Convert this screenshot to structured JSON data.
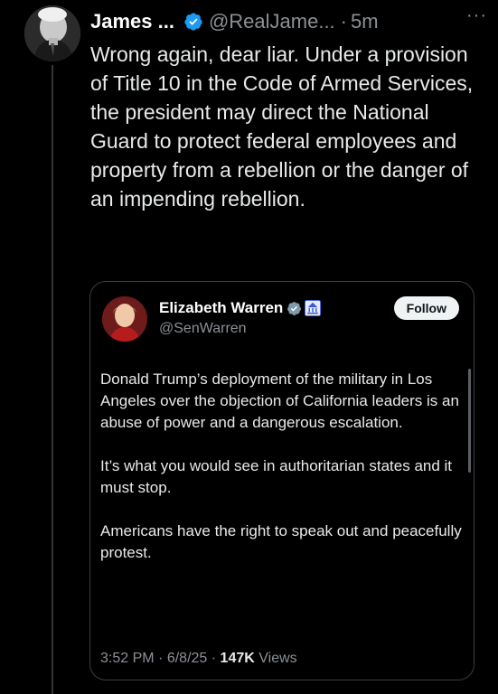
{
  "tweet": {
    "author_name": "James ...",
    "author_handle": "@RealJame...",
    "separator": "·",
    "time": "5m",
    "more_icon": "···",
    "text": "Wrong again, dear liar. Under a provision of Title 10 in the Code of Armed Services, the president may direct the National Guard to protect federal employees and property from a rebellion or the danger of an impending rebellion."
  },
  "quote": {
    "author_name": "Elizabeth Warren",
    "author_handle": "@SenWarren",
    "follow_label": "Follow",
    "paragraphs": [
      "Donald Trump’s deployment of the military in Los Angeles over the objection of California leaders is an abuse of power and a dangerous escalation.",
      "It’s what you would see in authoritarian states and it must stop.",
      "Americans have the right to speak out and peacefully protest."
    ],
    "time": "3:52 PM",
    "date": "6/8/25",
    "views_count": "147K",
    "views_label": "Views"
  },
  "colors": {
    "background": "#000000",
    "text": "#e7e9ea",
    "muted": "#8b9096",
    "verified": "#1d9bf0",
    "border": "#3a3d41"
  },
  "icons": {
    "verified": "verified-badge-icon",
    "government": "government-building-icon",
    "more": "more-options-icon"
  }
}
